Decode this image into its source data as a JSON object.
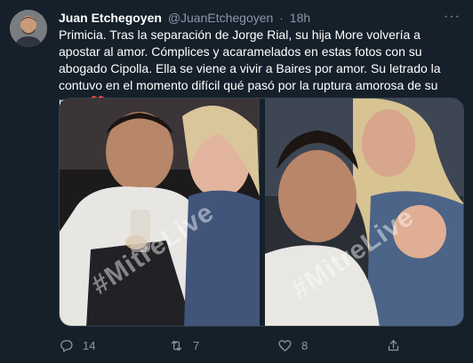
{
  "tweet": {
    "author_name": "Juan Etchegoyen",
    "author_handle": "@JuanEtchegoyen",
    "separator": "·",
    "time": "18h",
    "more_label": "···",
    "text": "Primicia.  Tras la separación de Jorge Rial, su hija More volvería a apostar al amor. Cómplices y acaramelados en estas fotos con su abogado Cipolla. Ella se viene a vivir a Baires por amor. Su letrado la contuvo en el momento difícil qué pasó por la ruptura amorosa de su papá",
    "emoji": "❤️",
    "watermark": "#MitreLive"
  },
  "actions": {
    "replies": "14",
    "retweets": "7",
    "likes": "8"
  },
  "colors": {
    "background": "#15202b",
    "secondary_text": "#8b98a5",
    "heart": "#f91c36"
  },
  "icons": [
    "reply-icon",
    "retweet-icon",
    "like-icon",
    "share-icon",
    "more-icon"
  ]
}
